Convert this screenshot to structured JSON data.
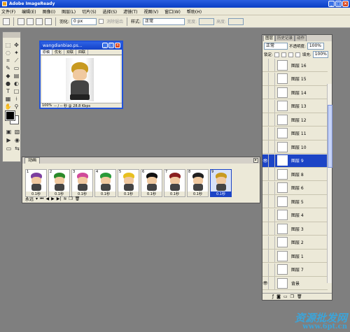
{
  "app": {
    "title": "Adobe ImageReady"
  },
  "menu": [
    "文件(F)",
    "编辑(E)",
    "图像(I)",
    "图层(L)",
    "切片(S)",
    "选择(S)",
    "滤镜(T)",
    "视图(V)",
    "窗口(W)",
    "帮助(H)"
  ],
  "options": {
    "feather_label": "羽化:",
    "feather_value": "0 px",
    "antialias_label": "消除锯齿",
    "style_label": "样式:",
    "style_value": "正常",
    "width_label": "宽度:",
    "height_label": "高度:"
  },
  "doc": {
    "title": "wangdianbiao.ps...",
    "tabs": [
      "原稿",
      "优化",
      "双联",
      "四联"
    ],
    "zoom": "100%",
    "status": "-- / -- 秒 @ 28.8 Kbps"
  },
  "animation": {
    "tab": "动画",
    "frames": [
      {
        "num": "1",
        "delay": "0.1秒",
        "hair": "#7c3fa0"
      },
      {
        "num": "2",
        "delay": "0.1秒",
        "hair": "#2a8a2a"
      },
      {
        "num": "3",
        "delay": "0.1秒",
        "hair": "#d04a9a"
      },
      {
        "num": "4",
        "delay": "0.1秒",
        "hair": "#2a9a3a"
      },
      {
        "num": "5",
        "delay": "0.1秒",
        "hair": "#e8c020"
      },
      {
        "num": "6",
        "delay": "0.1秒",
        "hair": "#111111"
      },
      {
        "num": "7",
        "delay": "0.1秒",
        "hair": "#8a2020"
      },
      {
        "num": "8",
        "delay": "0.1秒",
        "hair": "#202020"
      },
      {
        "num": "9",
        "delay": "0.1秒",
        "hair": "#c89a20"
      }
    ],
    "loop": "永远"
  },
  "layers": {
    "tabs": [
      "图层",
      "历史记录",
      "动作"
    ],
    "blend": "正常",
    "opacity_label": "不透明度:",
    "opacity": "100%",
    "lock_label": "锁定:",
    "fill_label": "填充:",
    "fill": "100%",
    "items": [
      {
        "name": "图层 16",
        "visible": false,
        "selected": false
      },
      {
        "name": "图层 15",
        "visible": false,
        "selected": false
      },
      {
        "name": "图层 14",
        "visible": false,
        "selected": false
      },
      {
        "name": "图层 13",
        "visible": false,
        "selected": false
      },
      {
        "name": "图层 12",
        "visible": false,
        "selected": false
      },
      {
        "name": "图层 11",
        "visible": false,
        "selected": false
      },
      {
        "name": "图层 10",
        "visible": false,
        "selected": false
      },
      {
        "name": "图层 9",
        "visible": true,
        "selected": true
      },
      {
        "name": "图层 8",
        "visible": false,
        "selected": false
      },
      {
        "name": "图层 6",
        "visible": false,
        "selected": false
      },
      {
        "name": "图层 5",
        "visible": false,
        "selected": false
      },
      {
        "name": "图层 4",
        "visible": false,
        "selected": false
      },
      {
        "name": "图层 3",
        "visible": false,
        "selected": false
      },
      {
        "name": "图层 2",
        "visible": false,
        "selected": false
      },
      {
        "name": "图层 1",
        "visible": false,
        "selected": false
      },
      {
        "name": "图层 7",
        "visible": false,
        "selected": false
      },
      {
        "name": "背景",
        "visible": true,
        "selected": false
      }
    ]
  },
  "watermark": {
    "line1": "资源批发网",
    "line2": "www.6pt.cn"
  },
  "colors": {
    "selection": "#1c44c6",
    "titlebar": "#0a3ec4"
  }
}
